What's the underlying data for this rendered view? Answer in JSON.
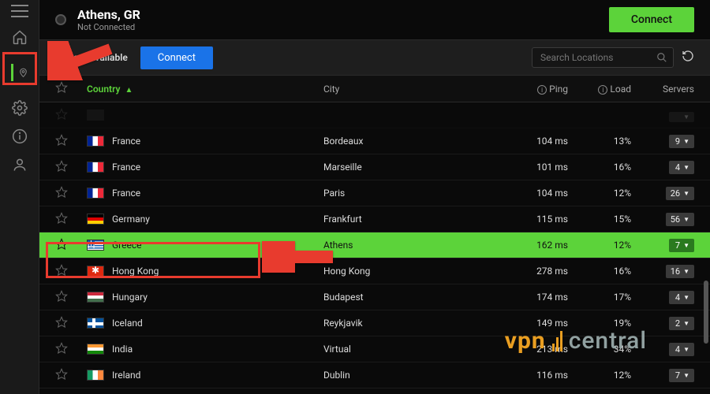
{
  "header": {
    "location": "Athens, GR",
    "status": "Not Connected",
    "connect_label": "Connect"
  },
  "subheader": {
    "fastest_label": "Fastest Available",
    "connect_label": "Connect",
    "search_placeholder": "Search Locations"
  },
  "columns": {
    "country": "Country",
    "city": "City",
    "ping": "Ping",
    "load": "Load",
    "servers": "Servers"
  },
  "rows": [
    {
      "flag": "xx",
      "country": "",
      "city": "",
      "ping": "",
      "load": "",
      "servers": "",
      "selected": false,
      "faded": true
    },
    {
      "flag": "fr",
      "country": "France",
      "city": "Bordeaux",
      "ping": "104 ms",
      "load": "13%",
      "servers": "9",
      "selected": false
    },
    {
      "flag": "fr",
      "country": "France",
      "city": "Marseille",
      "ping": "101 ms",
      "load": "16%",
      "servers": "4",
      "selected": false
    },
    {
      "flag": "fr",
      "country": "France",
      "city": "Paris",
      "ping": "104 ms",
      "load": "12%",
      "servers": "26",
      "selected": false
    },
    {
      "flag": "de",
      "country": "Germany",
      "city": "Frankfurt",
      "ping": "115 ms",
      "load": "15%",
      "servers": "56",
      "selected": false
    },
    {
      "flag": "gr",
      "country": "Greece",
      "city": "Athens",
      "ping": "162 ms",
      "load": "12%",
      "servers": "7",
      "selected": true
    },
    {
      "flag": "hk",
      "country": "Hong Kong",
      "city": "Hong Kong",
      "ping": "278 ms",
      "load": "16%",
      "servers": "16",
      "selected": false
    },
    {
      "flag": "hu",
      "country": "Hungary",
      "city": "Budapest",
      "ping": "174 ms",
      "load": "17%",
      "servers": "4",
      "selected": false
    },
    {
      "flag": "is",
      "country": "Iceland",
      "city": "Reykjavik",
      "ping": "149 ms",
      "load": "19%",
      "servers": "2",
      "selected": false
    },
    {
      "flag": "in",
      "country": "India",
      "city": "Virtual",
      "ping": "213 ms",
      "load": "34%",
      "servers": "4",
      "selected": false
    },
    {
      "flag": "ie",
      "country": "Ireland",
      "city": "Dublin",
      "ping": "116 ms",
      "load": "12%",
      "servers": "7",
      "selected": false
    }
  ],
  "watermark": {
    "part1": "vpn",
    "part2": "central"
  }
}
